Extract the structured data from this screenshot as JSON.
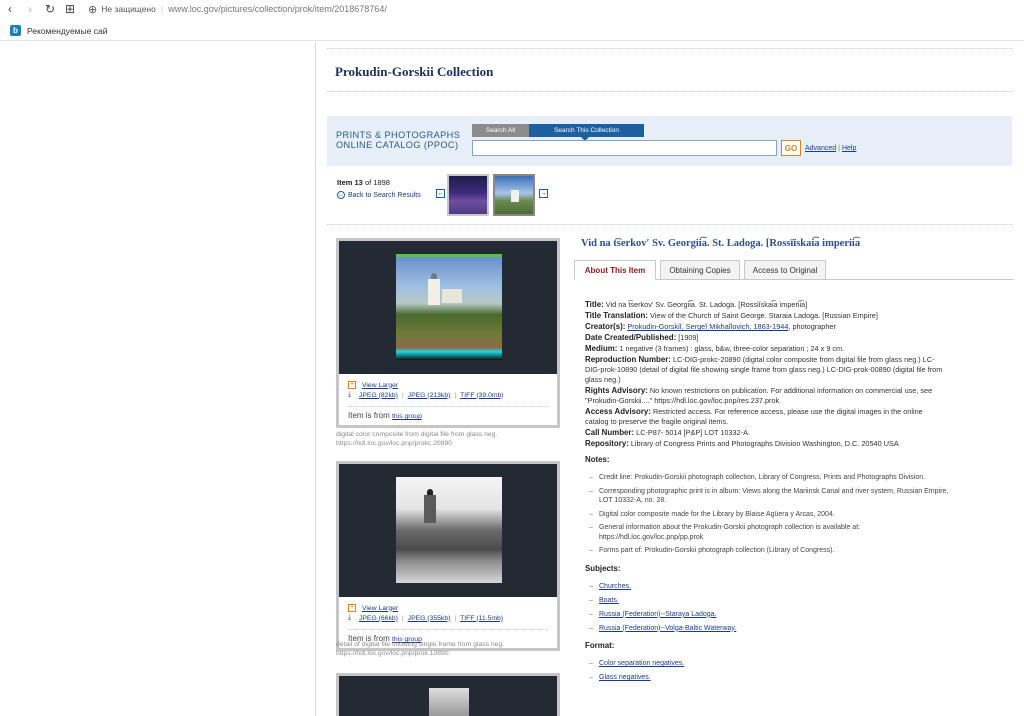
{
  "browser": {
    "security_label": "Не защищено",
    "url": "www.loc.gov/pictures/collection/prok/item/2018678764/",
    "bookmark_label": "Рекомендуемые сай"
  },
  "collection": {
    "title": "Prokudin-Gorskii Collection"
  },
  "search": {
    "ppoc_line1": "PRINTS & PHOTOGRAPHS",
    "ppoc_line2": "ONLINE CATALOG (PPOC)",
    "tab_all": "Search All",
    "tab_collection": "Search This Collection",
    "input_value": "",
    "go_label": "GO",
    "advanced_label": "Advanced",
    "separator": "|",
    "help_label": "Help"
  },
  "item_nav": {
    "item_word": "Item",
    "item_number": "13",
    "of_text": "of 1898",
    "back_label": "Back to Search Results"
  },
  "images": [
    {
      "view_larger": "View Larger",
      "jpeg_small": "JPEG (82kb)",
      "jpeg_large": "JPEG (213kb)",
      "tiff": "TIFF (39.0mb)",
      "item_from": "Item is from",
      "group_link": "this group",
      "caption_line1": "digital color composite from digital file from glass neg.",
      "caption_line2": "https://hdl.loc.gov/loc.pnp/prokc.20890"
    },
    {
      "view_larger": "View Larger",
      "jpeg_small": "JPEG (66kb)",
      "jpeg_large": "JPEG (355kb)",
      "tiff": "TIFF (11.5mb)",
      "item_from": "Item is from",
      "group_link": "this group",
      "caption_line1": "detail of digital file showing single frame from glass neg.",
      "caption_line2": "https://hdl.loc.gov/loc.pnp/prok.10890"
    }
  ],
  "item": {
    "title": "Vid na t͡serkovʹ Sv. Georgii͡a. St. Ladoga. [Rossīĭskai͡a imperii͡a",
    "tabs": [
      "About This Item",
      "Obtaining Copies",
      "Access to Original"
    ],
    "fields": {
      "title_label": "Title:",
      "title_value": "Vid na t͡serkovʹ Sv. Georgii͡a. St. Ladoga. [Rossiĭskai͡a imperii͡a]",
      "translation_label": "Title Translation:",
      "translation_value": "View of the Church of Saint George. Staraia Ladoga. [Russian Empire]",
      "creator_label": "Creator(s):",
      "creator_link": "Prokudin-Gorskiĭ, Sergeĭ Mikhaĭlovich, 1863-1944",
      "creator_role": ", photographer",
      "date_label": "Date Created/Published:",
      "date_value": "[1909]",
      "medium_label": "Medium:",
      "medium_value": "1 negative (3 frames) : glass, b&w, three-color separation ; 24 x 9 cm.",
      "repro_label": "Reproduction Number:",
      "repro_value": "LC-DIG-prokc-20890 (digital color composite from digital file from glass neg.) LC-DIG-prok-10890 (detail of digital file showing single frame from glass neg.) LC-DIG-prok-00890 (digital file from glass neg.)",
      "rights_label": "Rights Advisory:",
      "rights_value": "No known restrictions on publication. For additional information on commercial use, see \"Prokudin-Gorskii....\" https://hdl.loc.gov/loc.pnp/res.237.prok",
      "access_label": "Access Advisory:",
      "access_value": "Restricted access. For reference access, please use the digital images in the online catalog to preserve the fragile original items.",
      "call_label": "Call Number:",
      "call_value": "LC-P87- 5014 [P&P] LOT 10332-A.",
      "repo_label": "Repository:",
      "repo_value": "Library of Congress Prints and Photographs Division Washington, D.C. 20540 USA"
    },
    "notes_label": "Notes:",
    "notes": [
      "Credit line: Prokudin-Gorskii photograph collection, Library of Congress, Prints and Photographs Division.",
      "Corresponding photographic print is in album: Views along the Mariinsk Canal and river system, Russian Empire, LOT 10332-A, no. 28.",
      "Digital color composite made for the Library by Blaise Agüera y Arcas, 2004.",
      "General information about the Prokudin-Gorskii photograph collection is available at: https://hdl.loc.gov/loc.pnp/pp.prok",
      "Forms part of: Prokudin-Gorskii photograph collection (Library of Congress)."
    ],
    "subjects_label": "Subjects:",
    "subjects": [
      "Churches.",
      "Boats.",
      "Russia (Federation)--Staraya Ladoga.",
      "Russia (Federation)--Volga-Baltic Waterway."
    ],
    "format_label": "Format:",
    "formats": [
      "Color separation negatives.",
      "Glass negatives."
    ]
  }
}
